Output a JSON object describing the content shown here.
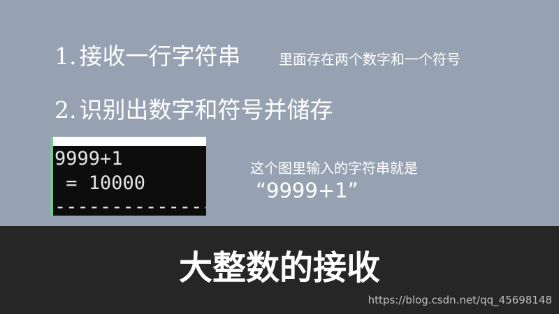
{
  "slide": {
    "point1": {
      "number": "1.",
      "text": "接收一行字符串",
      "note": "里面存在两个数字和一个符号"
    },
    "point2": {
      "number": "2.",
      "text": "识别出数字和符号并储存"
    },
    "console": {
      "line1": "9999+1",
      "line2": " = 10000",
      "line3": "-----------------"
    },
    "caption": {
      "text": "这个图里输入的字符串就是",
      "example": "“9999+1”"
    }
  },
  "footer": {
    "title": "大整数的接收",
    "watermark": "https://blog.csdn.net/qq_45698148"
  },
  "colors": {
    "slide_background": "#96a2b1",
    "footer_background": "#262626",
    "text": "#ffffff",
    "console_background": "#0d0d0d",
    "console_accent": "#7ec493"
  }
}
